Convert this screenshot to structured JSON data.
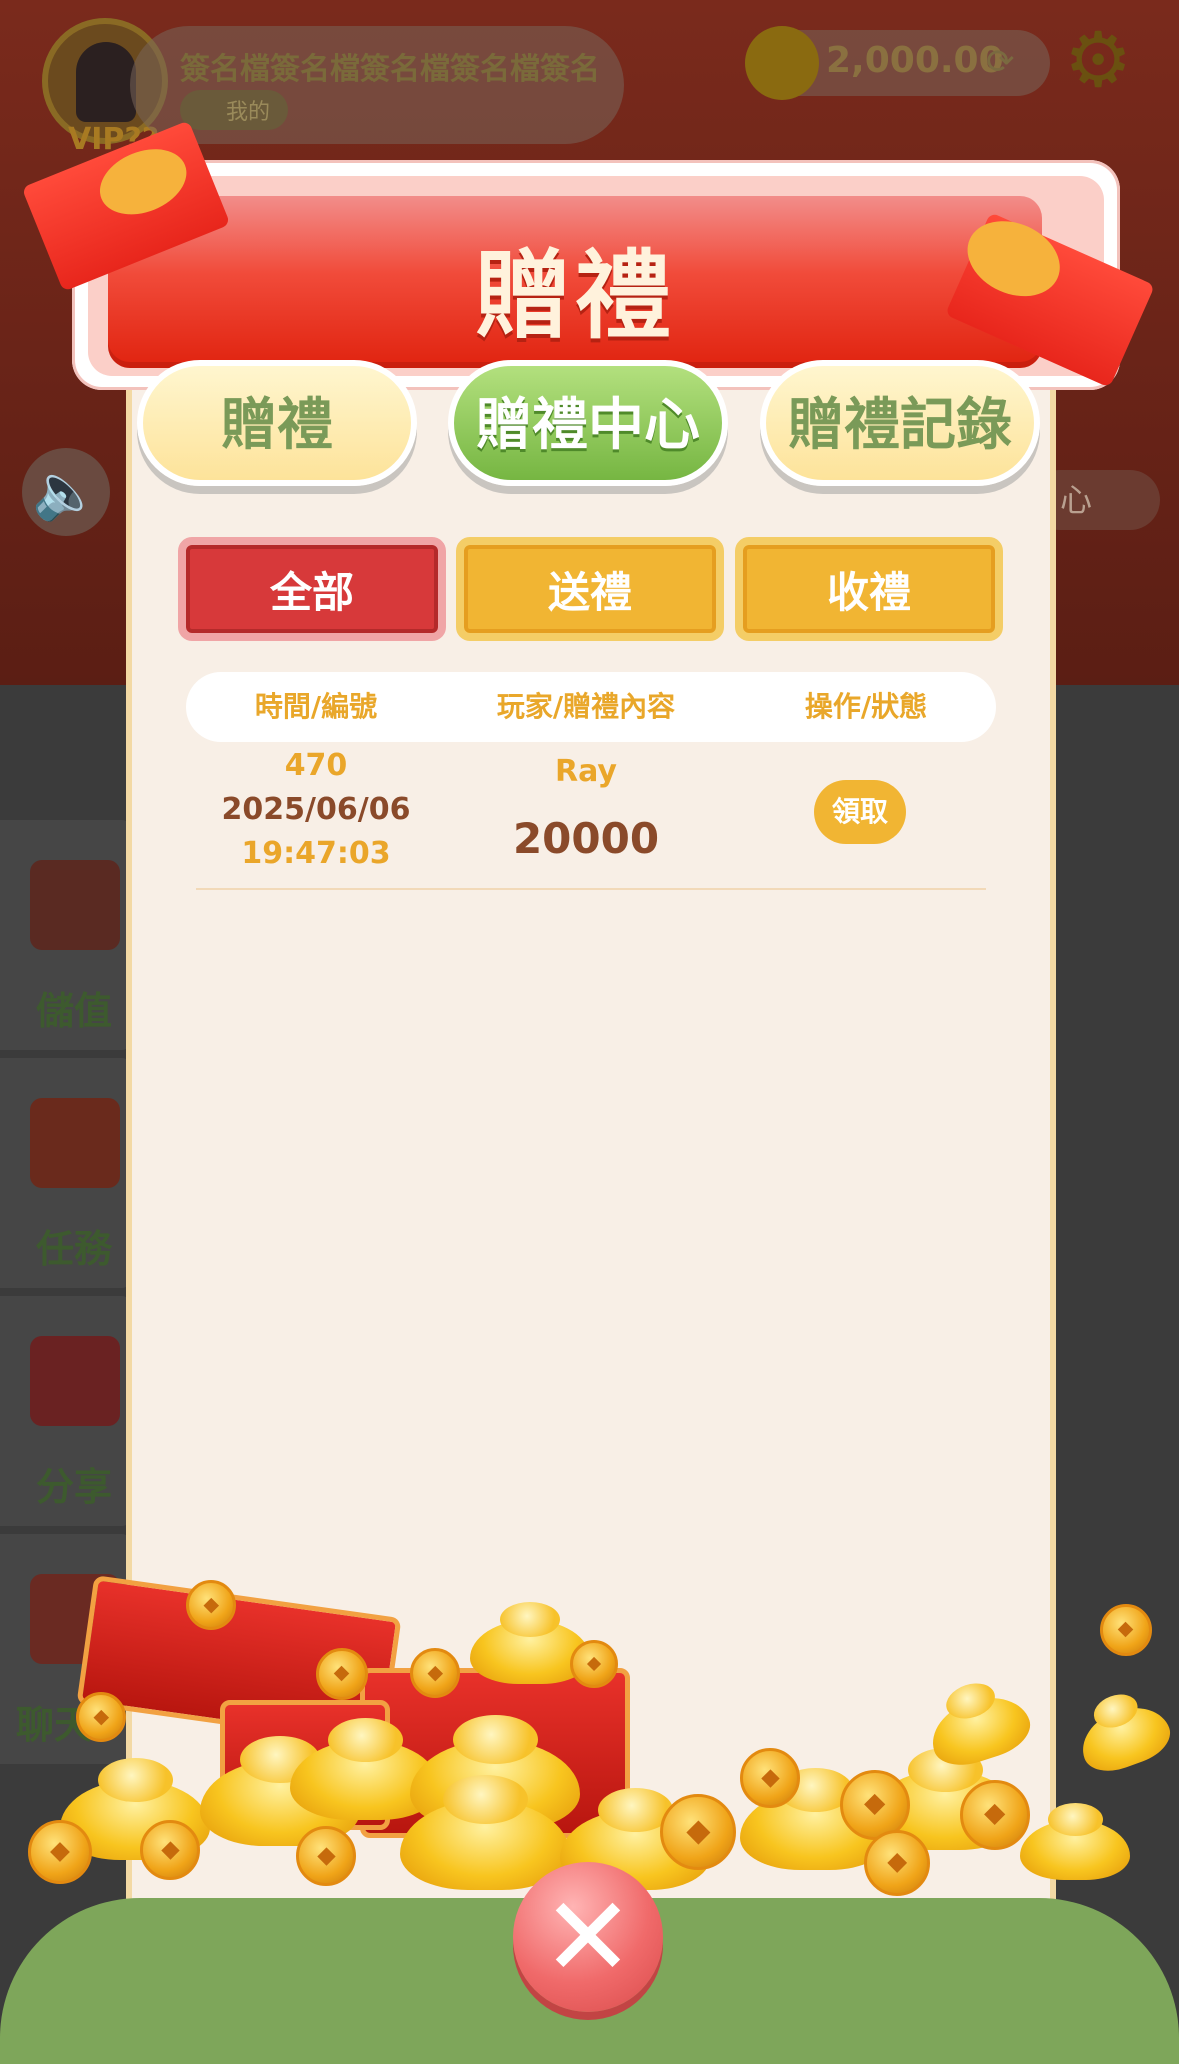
{
  "background": {
    "user_name": "簽名檔簽名檔簽名檔簽名檔簽名",
    "vip_label": "VIP??",
    "mine_label": "我的",
    "balance": "2,000.00",
    "center_label": "心",
    "side_menu": [
      "儲值",
      "任務",
      "分享",
      "聊天"
    ]
  },
  "modal": {
    "title": "贈禮",
    "tabs": [
      {
        "label": "贈禮",
        "active": false
      },
      {
        "label": "贈禮中心",
        "active": true
      },
      {
        "label": "贈禮記錄",
        "active": false
      }
    ],
    "filters": [
      {
        "label": "全部",
        "active": true
      },
      {
        "label": "送禮",
        "active": false
      },
      {
        "label": "收禮",
        "active": false
      }
    ],
    "table": {
      "headers": [
        "時間/編號",
        "玩家/贈禮內容",
        "操作/狀態"
      ],
      "rows": [
        {
          "id": "470",
          "date": "2025/06/06",
          "time": "19:47:03",
          "player": "Ray",
          "amount": "20000",
          "action": "領取"
        }
      ]
    }
  },
  "colors": {
    "accent_red": "#e0230f",
    "accent_gold": "#f1b533",
    "accent_green": "#76b642",
    "panel_bg": "#f8efe6"
  }
}
